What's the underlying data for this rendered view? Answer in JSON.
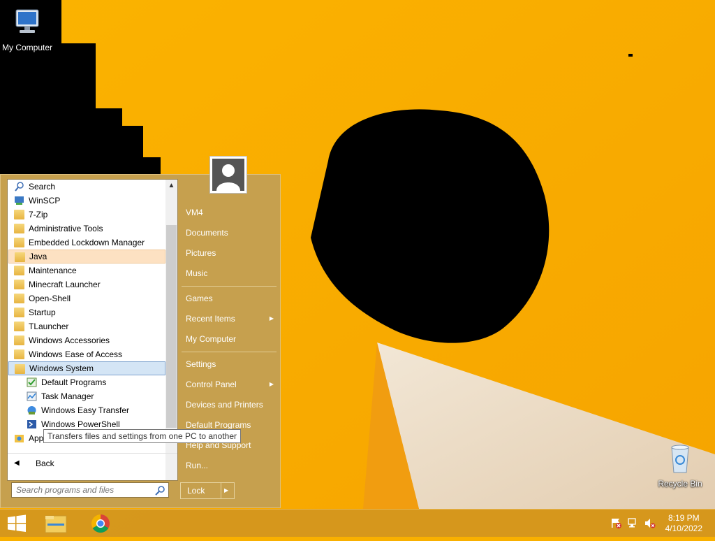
{
  "desktop": {
    "icons": [
      {
        "label": "My Computer",
        "icon": "my-computer-icon"
      },
      {
        "label": "Recycle Bin",
        "icon": "recycle-bin-icon"
      }
    ]
  },
  "start_menu": {
    "programs": [
      {
        "label": "Search",
        "icon": "search-icon"
      },
      {
        "label": "WinSCP",
        "icon": "winscp-icon"
      },
      {
        "label": "7-Zip",
        "icon": "folder-icon"
      },
      {
        "label": "Administrative Tools",
        "icon": "folder-icon"
      },
      {
        "label": "Embedded Lockdown Manager",
        "icon": "folder-icon"
      },
      {
        "label": "Java",
        "icon": "folder-icon",
        "state": "hover"
      },
      {
        "label": "Maintenance",
        "icon": "folder-icon"
      },
      {
        "label": "Minecraft Launcher",
        "icon": "folder-icon"
      },
      {
        "label": "Open-Shell",
        "icon": "folder-icon"
      },
      {
        "label": "Startup",
        "icon": "folder-icon"
      },
      {
        "label": "TLauncher",
        "icon": "folder-icon"
      },
      {
        "label": "Windows Accessories",
        "icon": "folder-icon"
      },
      {
        "label": "Windows Ease of Access",
        "icon": "folder-icon"
      },
      {
        "label": "Windows System",
        "icon": "folder-icon",
        "state": "expanded"
      },
      {
        "label": "Default Programs",
        "icon": "default-programs-icon"
      },
      {
        "label": "Task Manager",
        "icon": "task-manager-icon"
      },
      {
        "label": "Windows Easy Transfer",
        "icon": "easy-transfer-icon"
      },
      {
        "label": "Windows PowerShell",
        "icon": "powershell-icon"
      },
      {
        "label": "Apps",
        "icon": "apps-icon"
      }
    ],
    "back_label": "Back",
    "search_placeholder": "Search programs and files",
    "right_pane": [
      {
        "label": "VM4"
      },
      {
        "label": "Documents"
      },
      {
        "label": "Pictures"
      },
      {
        "label": "Music"
      },
      {
        "label": "Games"
      },
      {
        "label": "Recent Items",
        "submenu": true
      },
      {
        "label": "My Computer"
      },
      {
        "label": "Settings"
      },
      {
        "label": "Control Panel",
        "submenu": true
      },
      {
        "label": "Devices and Printers"
      },
      {
        "label": "Default Programs"
      },
      {
        "label": "Help and Support"
      },
      {
        "label": "Run..."
      }
    ],
    "lock_label": "Lock"
  },
  "tooltip": "Transfers files and settings from one PC to another",
  "taskbar": {
    "buttons": [
      "windows-start-icon",
      "file-explorer-icon",
      "chrome-icon"
    ],
    "tray": [
      "action-center-flag-icon",
      "network-icon",
      "volume-muted-icon"
    ],
    "time": "8:19 PM",
    "date": "4/10/2022"
  },
  "colors": {
    "wallpaper_orange": "#f9b000",
    "start_menu_bg": "#c6a04e",
    "taskbar_bg": "#d2961e"
  }
}
